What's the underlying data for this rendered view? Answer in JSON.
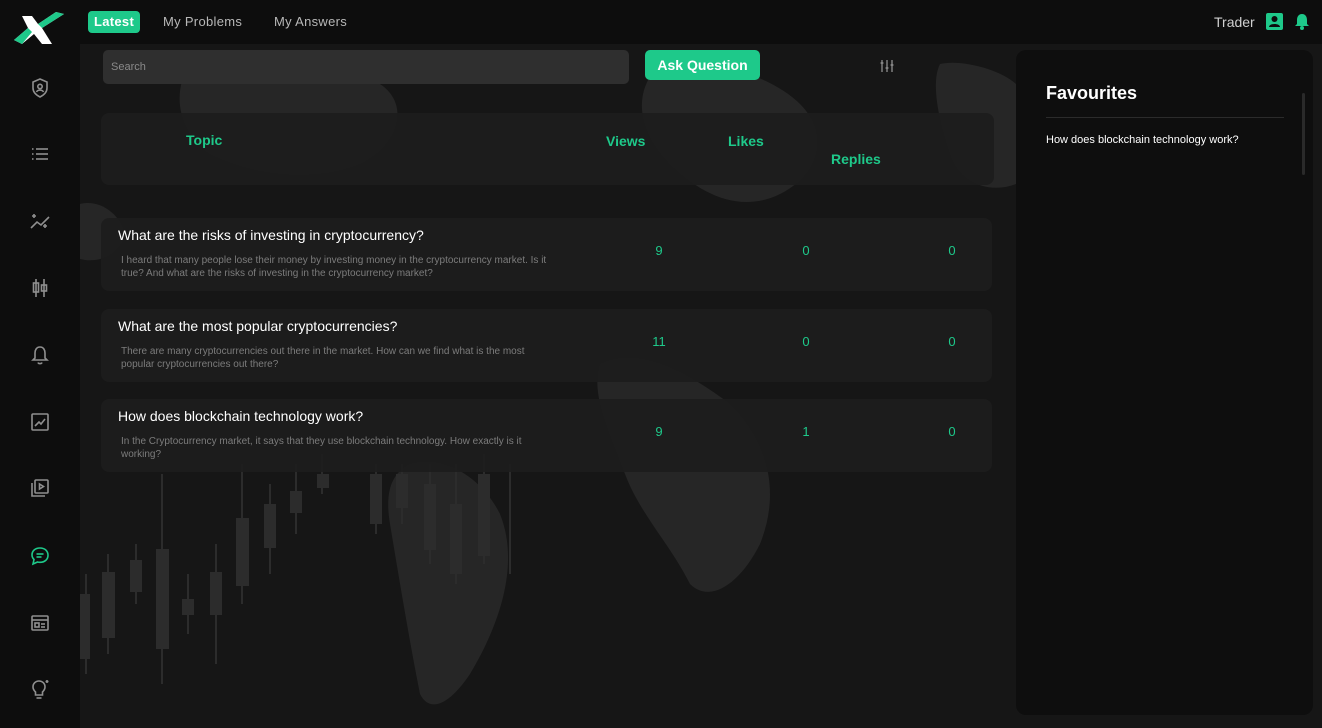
{
  "nav": {
    "tabs": [
      {
        "label": "Latest",
        "active": true
      },
      {
        "label": "My Problems",
        "active": false
      },
      {
        "label": "My Answers",
        "active": false
      }
    ],
    "user_name": "Trader"
  },
  "sidebar": {
    "items": [
      {
        "icon": "shield-user-icon"
      },
      {
        "icon": "list-icon"
      },
      {
        "icon": "sparkle-chart-icon"
      },
      {
        "icon": "candlestick-icon"
      },
      {
        "icon": "bell-icon"
      },
      {
        "icon": "chart-image-icon"
      },
      {
        "icon": "video-library-icon"
      },
      {
        "icon": "chat-icon",
        "active": true
      },
      {
        "icon": "calendar-window-icon"
      },
      {
        "icon": "lightbulb-icon"
      }
    ]
  },
  "search": {
    "placeholder": "Search"
  },
  "actions": {
    "ask_label": "Ask Question"
  },
  "table": {
    "headers": {
      "topic": "Topic",
      "views": "Views",
      "likes": "Likes",
      "replies": "Replies"
    },
    "rows": [
      {
        "title": "What are the risks of investing in cryptocurrency?",
        "description": "I heard that many people lose their money by investing money in the cryptocurrency market. Is it true? And what are the risks of investing in the cryptocurrency market?",
        "views": "9",
        "likes": "0",
        "replies": "0"
      },
      {
        "title": "What are the most popular cryptocurrencies?",
        "description": "There are many cryptocurrencies out there in the market. How can we find what is the most popular cryptocurrencies out there?",
        "views": "11",
        "likes": "0",
        "replies": "0"
      },
      {
        "title": "How does blockchain technology work?",
        "description": "In the Cryptocurrency market, it says that they use blockchain technology. How exactly is it working?",
        "views": "9",
        "likes": "1",
        "replies": "0"
      }
    ]
  },
  "favourites": {
    "title": "Favourites",
    "items": [
      "How does blockchain technology work?"
    ]
  },
  "colors": {
    "accent": "#1ec98a",
    "background": "#161616",
    "panel": "#0d0d0d",
    "card": "#1d1d1d"
  }
}
